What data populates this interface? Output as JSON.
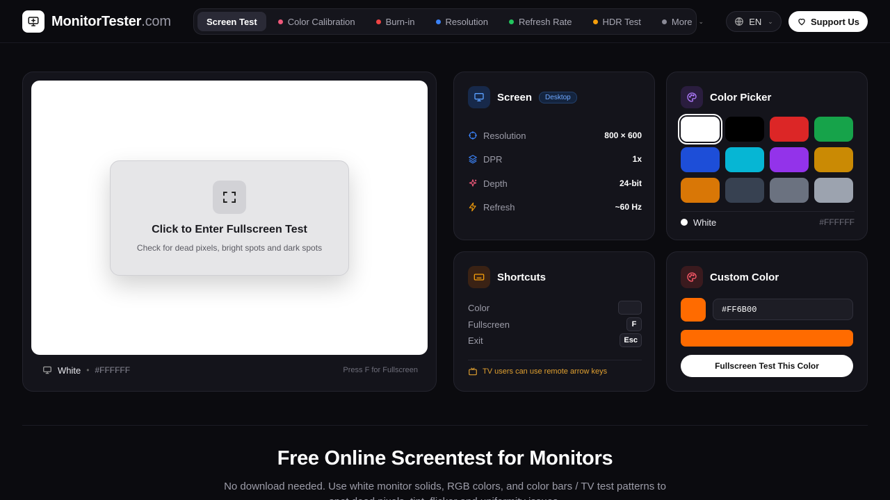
{
  "header": {
    "logo_main": "MonitorTester",
    "logo_domain": ".com",
    "nav": [
      {
        "label": "Screen Test",
        "color": ""
      },
      {
        "label": "Color Calibration",
        "color": "#f0587a"
      },
      {
        "label": "Burn-in",
        "color": "#ef4444"
      },
      {
        "label": "Resolution",
        "color": "#3b82f6"
      },
      {
        "label": "Refresh Rate",
        "color": "#22c55e"
      },
      {
        "label": "HDR Test",
        "color": "#f59e0b"
      },
      {
        "label": "More",
        "color": "#8a8a96"
      }
    ],
    "language": "EN",
    "support_label": "Support Us"
  },
  "preview": {
    "background": "#FFFFFF",
    "fullscreen_title": "Click to Enter Fullscreen Test",
    "fullscreen_subtitle": "Check for dead pixels, bright spots and dark spots",
    "footer_name": "White",
    "footer_separator": "•",
    "footer_hex": "#FFFFFF",
    "footer_hint": "Press F for Fullscreen"
  },
  "screen": {
    "title": "Screen",
    "badge": "Desktop",
    "specs": [
      {
        "label": "Resolution",
        "value": "800 × 600",
        "icon": "crosshair-icon",
        "color": "#3b82f6"
      },
      {
        "label": "DPR",
        "value": "1x",
        "icon": "layers-icon",
        "color": "#3b82f6"
      },
      {
        "label": "Depth",
        "value": "24-bit",
        "icon": "sparkle-icon",
        "color": "#f0587a"
      },
      {
        "label": "Refresh",
        "value": "~60 Hz",
        "icon": "bolt-icon",
        "color": "#f59e0b"
      }
    ]
  },
  "picker": {
    "title": "Color Picker",
    "swatches": [
      "#FFFFFF",
      "#000000",
      "#DC2626",
      "#16A34A",
      "#1D4ED8",
      "#06B6D4",
      "#9333EA",
      "#CA8A04",
      "#D97706",
      "#374151",
      "#6B7280",
      "#9CA3AF"
    ],
    "selected_index": 0,
    "selected_name": "White",
    "selected_hex": "#FFFFFF"
  },
  "shortcuts": {
    "title": "Shortcuts",
    "rows": [
      {
        "label": "Color",
        "key": ""
      },
      {
        "label": "Fullscreen",
        "key": "F"
      },
      {
        "label": "Exit",
        "key": "Esc"
      }
    ],
    "tv_note": "TV users can use remote arrow keys"
  },
  "custom": {
    "title": "Custom Color",
    "value": "#FF6B00",
    "button_label": "Fullscreen Test This Color"
  },
  "hero": {
    "title": "Free Online Screentest for Monitors",
    "subtitle": "No download needed. Use white monitor solids, RGB colors, and color bars / TV test patterns to spot dead pixels, tint, flicker and uniformity issues."
  }
}
